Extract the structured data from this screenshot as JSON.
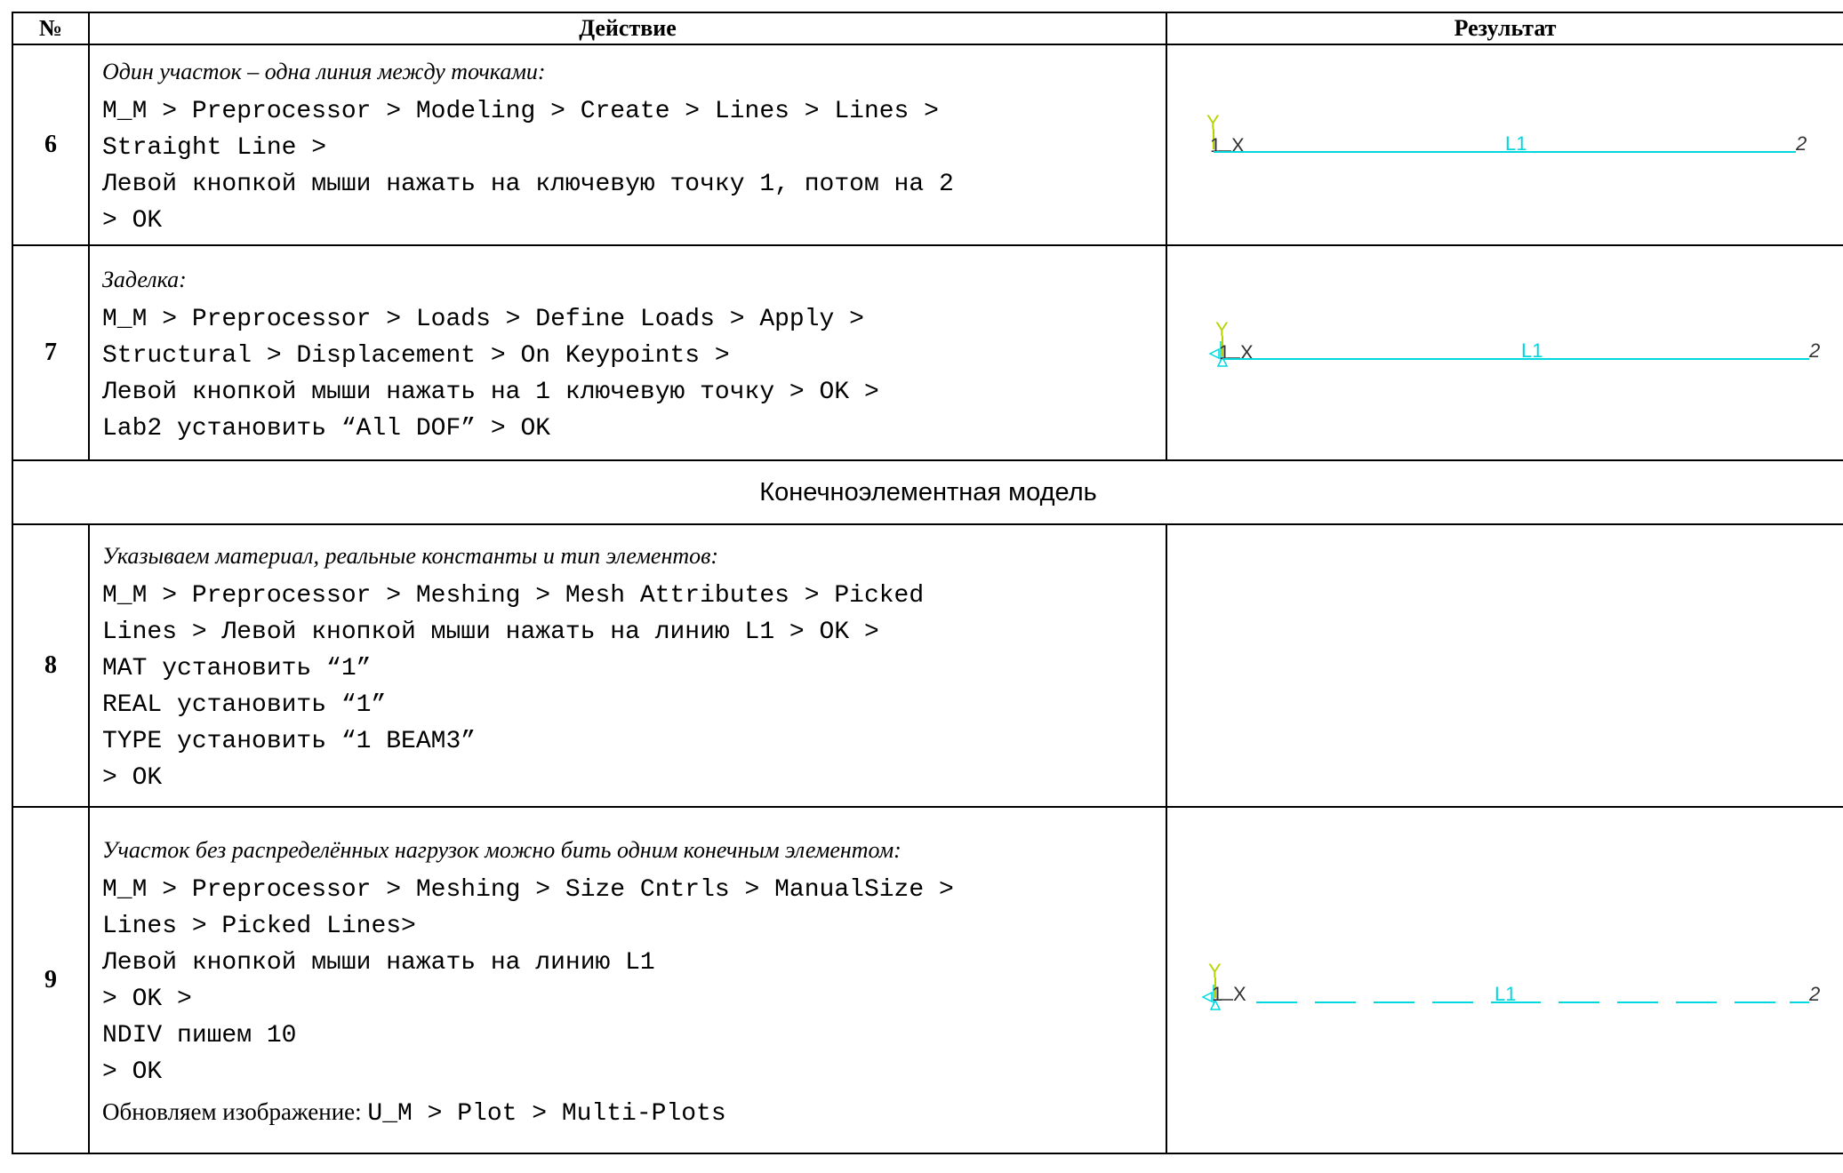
{
  "header": {
    "num": "№",
    "action": "Действие",
    "result": "Результат"
  },
  "rows": [
    {
      "num": "6",
      "title": "Один участок –  одна линия между точками:",
      "lines": [
        "M_M > Preprocessor > Modeling > Create > Lines > Lines >",
        "Straight Line >",
        "Левой кнопкой мыши нажать на ключевую точку 1, потом на 2",
        "> OK"
      ]
    },
    {
      "num": "7",
      "title": "Заделка:",
      "lines": [
        "M_M > Preprocessor > Loads > Define Loads > Apply >",
        "Structural > Displacement > On Keypoints >",
        "Левой кнопкой мыши нажать на 1 ключевую точку > OK >",
        "Lab2 установить “All DOF” > OK"
      ]
    },
    {
      "num": "8",
      "title": "Указываем материал, реальные константы и тип элементов:",
      "lines": [
        "M_M > Preprocessor > Meshing > Mesh Attributes > Picked",
        "Lines > Левой кнопкой мыши нажать на линию L1 > OK >",
        "MAT установить “1”",
        "REAL установить “1”",
        "TYPE установить “1 BEAM3”",
        "> OK"
      ]
    },
    {
      "num": "9",
      "title": "Участок без распределённых нагрузок можно бить одним конечным элементом:",
      "lines": [
        "M_M > Preprocessor > Meshing > Size Cntrls > ManualSize >",
        "Lines > Picked Lines>",
        "Левой кнопкой мыши нажать на линию L1",
        "> OK >",
        "NDIV пишем 10",
        "> OK"
      ],
      "footer_label": "Обновляем изображение: ",
      "footer_code": "U_M > Plot > Multi-Plots"
    }
  ],
  "section_title": "Конечноэлементная модель",
  "plots": {
    "y_label": "Y",
    "x_label": "X",
    "kp1_label": "1",
    "line_label": "L1",
    "kp2_label": "2",
    "axis_color_y": "#b8d400",
    "axis_color_x": "#333333",
    "line_color": "#00d8e0",
    "icon": "ansys-line-plot"
  }
}
